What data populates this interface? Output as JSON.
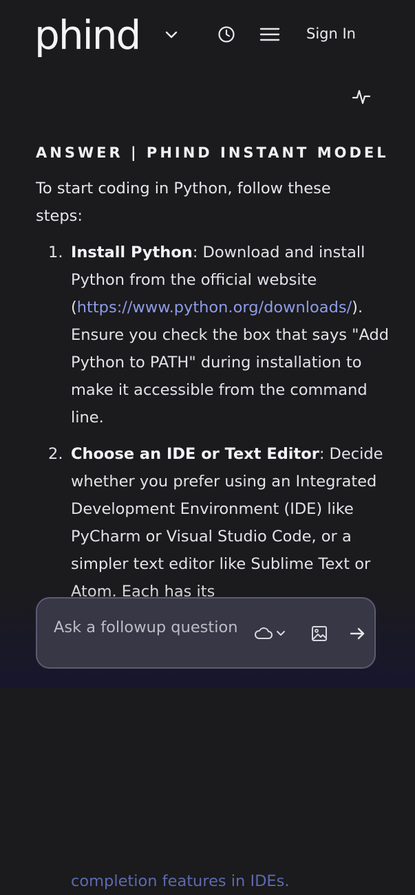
{
  "header": {
    "logo": "phind",
    "sign_in_label": "Sign In",
    "icons": {
      "logo_caret": "chevron-down-icon",
      "history": "clock-icon",
      "menu": "hamburger-menu-icon",
      "activity": "activity-pulse-icon"
    }
  },
  "answer": {
    "heading": "ANSWER | PHIND INSTANT MODEL",
    "intro": "To start coding in Python, follow these steps:",
    "steps": [
      {
        "number": "1.",
        "title": "Install Python",
        "text_before_link": ": Download and install Python from the official website (",
        "link": "https://www.python.org/downloads/",
        "text_after_link": "). Ensure you check the box that says \"Add Python to PATH\" during installation to make it accessible from the command line."
      },
      {
        "number": "2.",
        "title": "Choose an IDE or Text Editor",
        "text": ": Decide whether you prefer using an Integrated Development Environment (IDE) like PyCharm or Visual Studio Code, or a simpler text editor like Sublime Text or Atom. Each has its",
        "trailing_text": "completion features in IDEs."
      }
    ]
  },
  "followup": {
    "placeholder": "Ask a followup question",
    "value": "",
    "icons": {
      "model": "cloud-icon",
      "model_caret": "chevron-down-icon",
      "image": "image-icon",
      "send": "arrow-right-icon"
    }
  },
  "colors": {
    "background": "#1b1a1c",
    "text": "#e6e5ea",
    "link": "#8d9ce8",
    "input_bg": "#3a3a48",
    "input_border": "#5c5b74"
  }
}
